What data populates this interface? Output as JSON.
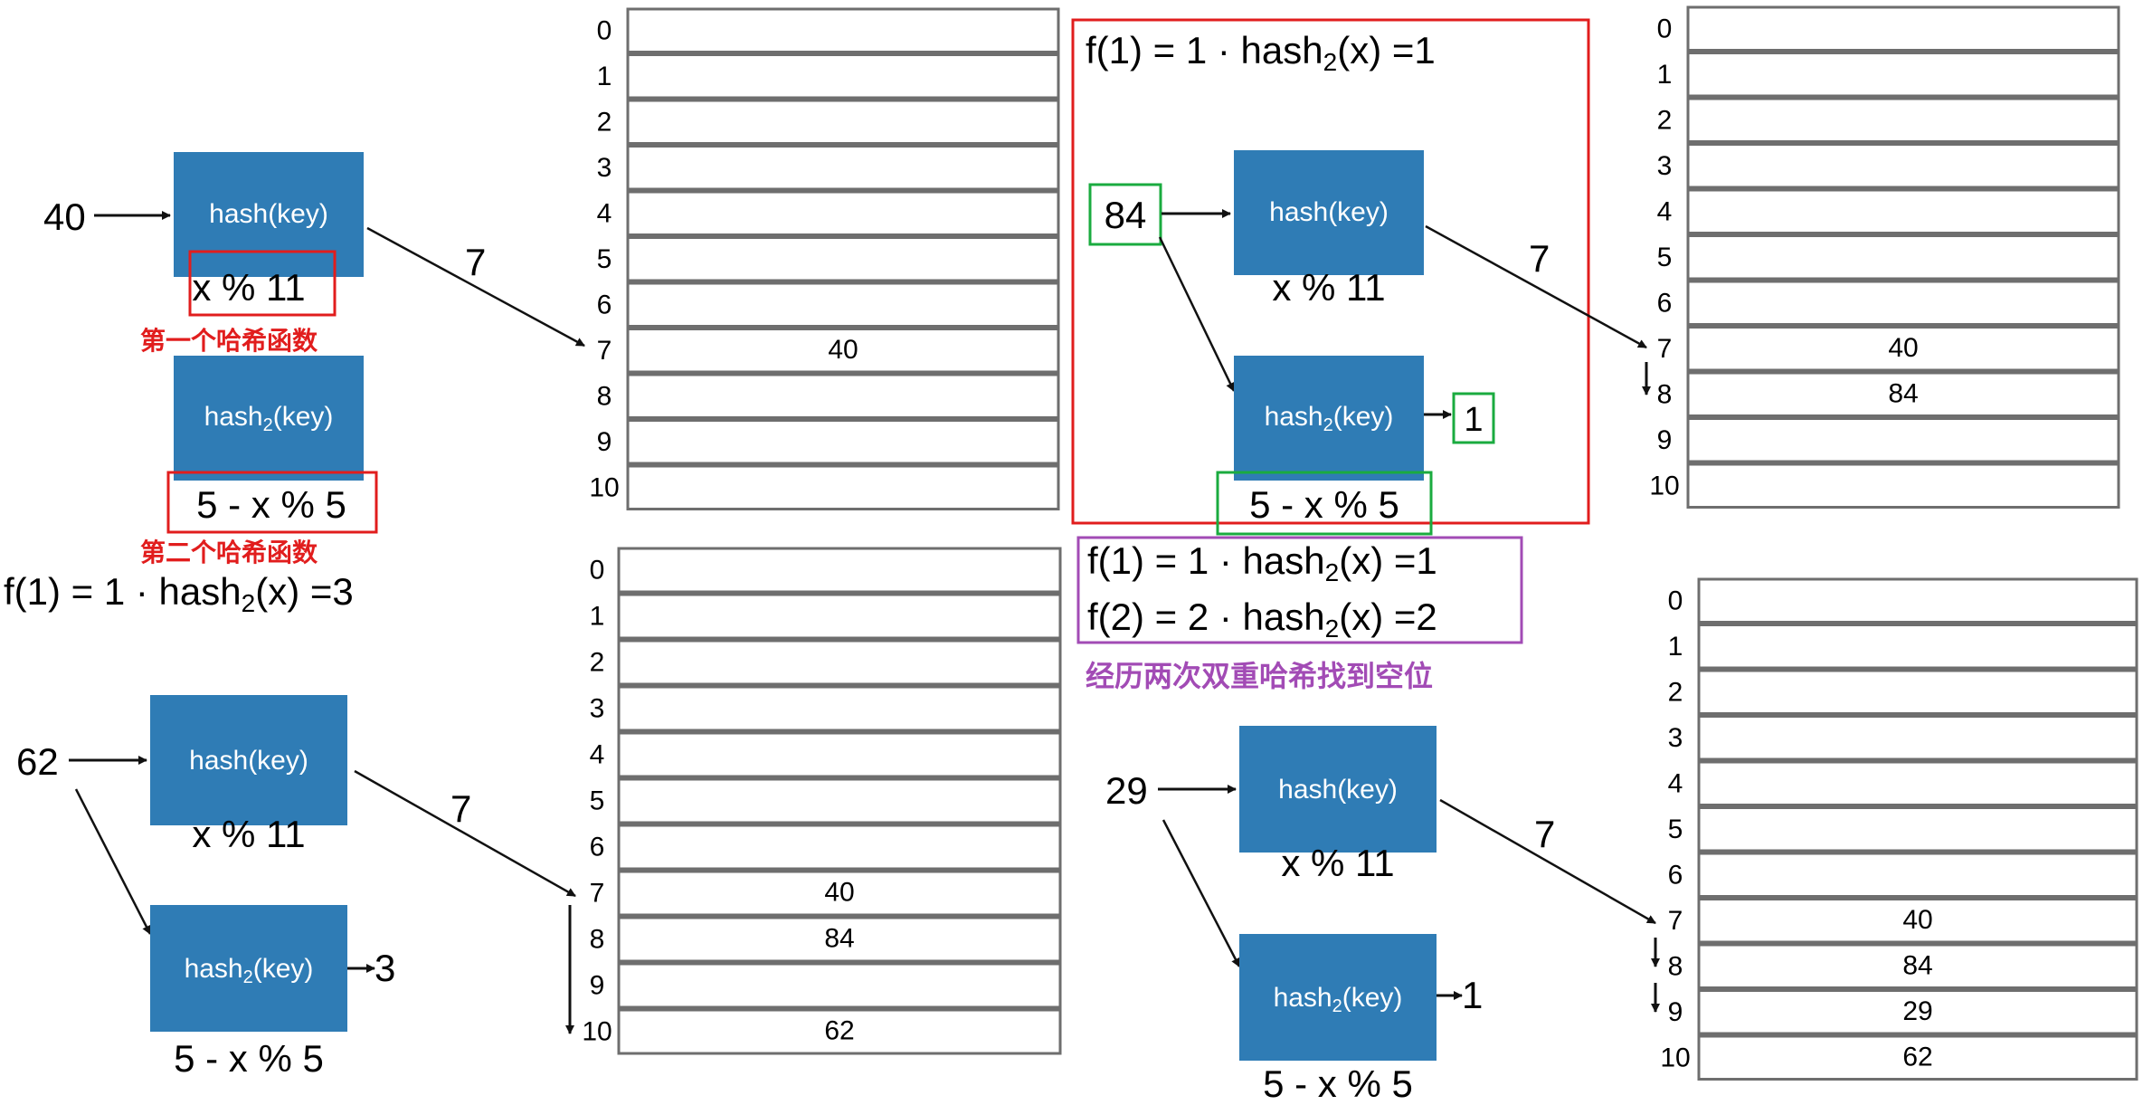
{
  "colors": {
    "box_blue": "#2f7cb5",
    "red": "#e11d1d",
    "green": "#1aab3f",
    "purple": "#a24bb5",
    "cell_border": "#6e6e6e"
  },
  "labels": {
    "hash1": "hash(key)",
    "hash2_prefix": "hash",
    "hash2_sub": "2",
    "hash2_suffix": "(key)",
    "mod11": "x % 11",
    "mod5": "5 - x % 5",
    "arrow7": "7",
    "first_hash_note": "第一个哈希函数",
    "second_hash_note": "第二个哈希函数",
    "double_hash_note": "经历两次双重哈希找到空位"
  },
  "formulas": {
    "f1_3": {
      "pre": "f(1) = 1 · hash",
      "sub": "2",
      "post": "(x) =3"
    },
    "f1_1": {
      "pre": "f(1) = 1 · hash",
      "sub": "2",
      "post": "(x) =1"
    },
    "f2_2": {
      "pre": "f(2) = 2 · hash",
      "sub": "2",
      "post": "(x) =2"
    }
  },
  "keys": {
    "k40": "40",
    "k62": "62",
    "k84": "84",
    "k29": "29"
  },
  "results": {
    "r3": "3",
    "r1a": "1",
    "r1b": "1"
  },
  "table_indices": [
    "0",
    "1",
    "2",
    "3",
    "4",
    "5",
    "6",
    "7",
    "8",
    "9",
    "10"
  ],
  "tables": {
    "t1": {
      "7": "40"
    },
    "t2": {
      "7": "40",
      "8": "84",
      "10": "62"
    },
    "t3": {
      "7": "40",
      "8": "84"
    },
    "t4": {
      "7": "40",
      "8": "84",
      "9": "29",
      "10": "62"
    }
  }
}
